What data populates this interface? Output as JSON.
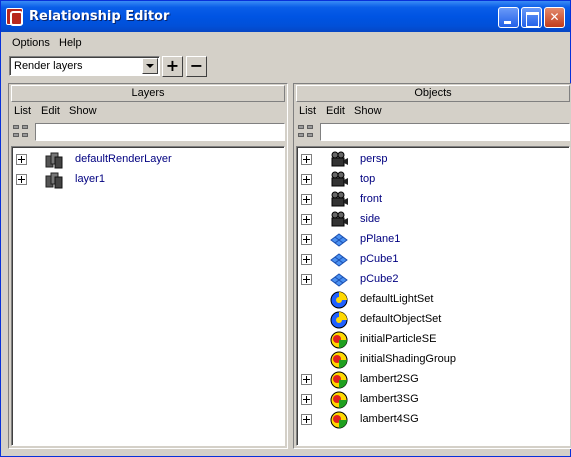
{
  "window": {
    "title": "Relationship Editor"
  },
  "colors": {
    "title_bar": "#0054e3",
    "link_text": "#000080",
    "plain_text": "#000000",
    "face": "#d4d0c8"
  },
  "menu": {
    "options": "Options",
    "help": "Help"
  },
  "toolbar": {
    "mode_value": "Render layers",
    "add_label": "+",
    "remove_label": "−"
  },
  "layers": {
    "header": "Layers",
    "menu": {
      "list": "List",
      "edit": "Edit",
      "show": "Show"
    },
    "items": [
      {
        "label": "defaultRenderLayer",
        "icon": "render-layer-icon",
        "expandable": true
      },
      {
        "label": "layer1",
        "icon": "render-layer-icon",
        "expandable": true
      }
    ]
  },
  "objects": {
    "header": "Objects",
    "menu": {
      "list": "List",
      "edit": "Edit",
      "show": "Show"
    },
    "items": [
      {
        "label": "persp",
        "icon": "camera-icon",
        "expandable": true,
        "linked": true
      },
      {
        "label": "top",
        "icon": "camera-icon",
        "expandable": true,
        "linked": true
      },
      {
        "label": "front",
        "icon": "camera-icon",
        "expandable": true,
        "linked": true
      },
      {
        "label": "side",
        "icon": "camera-icon",
        "expandable": true,
        "linked": true
      },
      {
        "label": "pPlane1",
        "icon": "mesh-icon",
        "expandable": true,
        "linked": true
      },
      {
        "label": "pCube1",
        "icon": "mesh-icon",
        "expandable": true,
        "linked": true
      },
      {
        "label": "pCube2",
        "icon": "mesh-icon",
        "expandable": true,
        "linked": true
      },
      {
        "label": "defaultLightSet",
        "icon": "set-icon",
        "expandable": false,
        "linked": false
      },
      {
        "label": "defaultObjectSet",
        "icon": "set-icon",
        "expandable": false,
        "linked": false
      },
      {
        "label": "initialParticleSE",
        "icon": "shading-group-icon",
        "expandable": false,
        "linked": false
      },
      {
        "label": "initialShadingGroup",
        "icon": "shading-group-icon",
        "expandable": false,
        "linked": false
      },
      {
        "label": "lambert2SG",
        "icon": "shading-group-icon",
        "expandable": true,
        "linked": false
      },
      {
        "label": "lambert3SG",
        "icon": "shading-group-icon",
        "expandable": true,
        "linked": false
      },
      {
        "label": "lambert4SG",
        "icon": "shading-group-icon",
        "expandable": true,
        "linked": false
      }
    ]
  }
}
